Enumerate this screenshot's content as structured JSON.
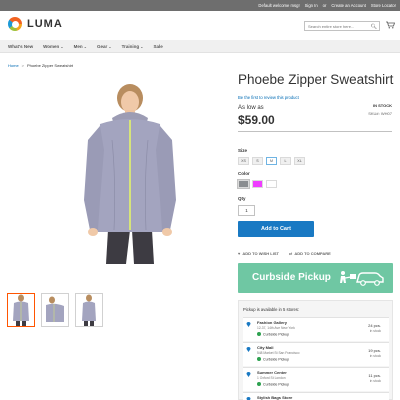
{
  "top_links": [
    "Default welcome msg!",
    "Sign In",
    "or",
    "Create an Account",
    "Store Locator"
  ],
  "logo_text": "LUMA",
  "search": {
    "placeholder": "Search entire store here..."
  },
  "nav": [
    {
      "label": "What's New",
      "has_dropdown": false
    },
    {
      "label": "Women",
      "has_dropdown": true
    },
    {
      "label": "Men",
      "has_dropdown": true
    },
    {
      "label": "Gear",
      "has_dropdown": true
    },
    {
      "label": "Training",
      "has_dropdown": true
    },
    {
      "label": "Sale",
      "has_dropdown": false
    }
  ],
  "breadcrumb": {
    "home": "Home",
    "separator": ">",
    "current": "Phoebe Zipper Sweatshirt"
  },
  "product": {
    "title": "Phoebe Zipper Sweatshirt",
    "review_link": "Be the first to review this product",
    "as_low_as": "As low as",
    "price": "$59.00",
    "stock": "IN STOCK",
    "sku": "SKU#:  WH07",
    "size_label": "Size",
    "sizes": [
      "XS",
      "S",
      "M",
      "L",
      "XL"
    ],
    "selected_size": "M",
    "color_label": "Color",
    "colors": [
      "#8a8d90",
      "#ef3dff",
      "#ffffff"
    ],
    "qty_label": "Qty",
    "qty_value": "1",
    "add_to_cart": "Add to Cart",
    "wishlist": "ADD TO WISH LIST",
    "compare": "ADD TO COMPARE"
  },
  "curbside": {
    "label": "Curbside Pickup",
    "color": "#6fc7a3"
  },
  "pickup": {
    "heading": "Pickup is available in 5 stores:",
    "stores": [
      {
        "name": "Fashion Gallery",
        "address": "12-37, 14th Ave New York",
        "pickup": "Curbside Pickup",
        "qty": "24 pcs.",
        "qty_label": "in stock"
      },
      {
        "name": "City Mall",
        "address": "548 Market St San Francisco",
        "pickup": "Curbside Pickup",
        "qty": "19 pcs.",
        "qty_label": "in stock"
      },
      {
        "name": "Summer Center",
        "address": "1 Oxford St London",
        "pickup": "Curbside Pickup",
        "qty": "11 pcs.",
        "qty_label": "in stock"
      },
      {
        "name": "Stylish Bags Store",
        "address": "",
        "pickup": "",
        "qty": "",
        "qty_label": ""
      }
    ]
  },
  "colors": {
    "link": "#006bb4",
    "primary_button": "#1979c3",
    "pickup_green": "#2da14f"
  }
}
